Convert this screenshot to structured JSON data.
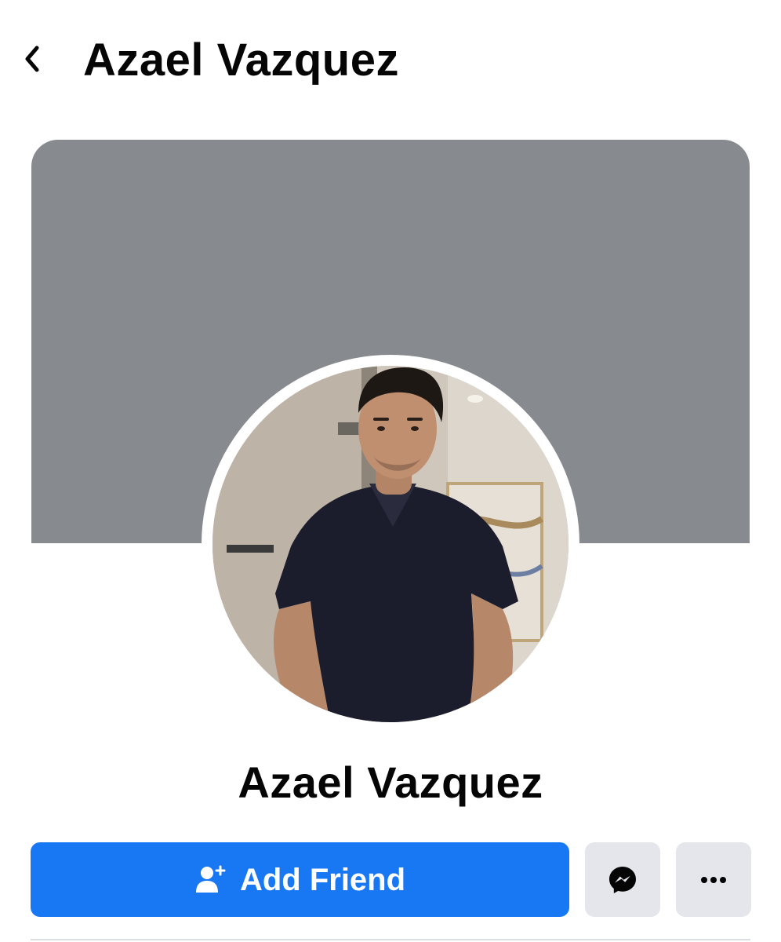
{
  "header": {
    "back_icon": "chevron-left-icon",
    "title": "Azael Vazquez"
  },
  "cover": {
    "color": "#878b8f"
  },
  "profile": {
    "name": "Azael Vazquez",
    "avatar_icon": "profile-photo"
  },
  "actions": {
    "add_friend_label": "Add Friend",
    "add_friend_icon": "add-user-icon",
    "messenger_icon": "messenger-icon",
    "more_icon": "more-options-icon"
  },
  "colors": {
    "accent": "#1877f2",
    "secondary_button": "#e4e6eb",
    "text": "#050505"
  }
}
